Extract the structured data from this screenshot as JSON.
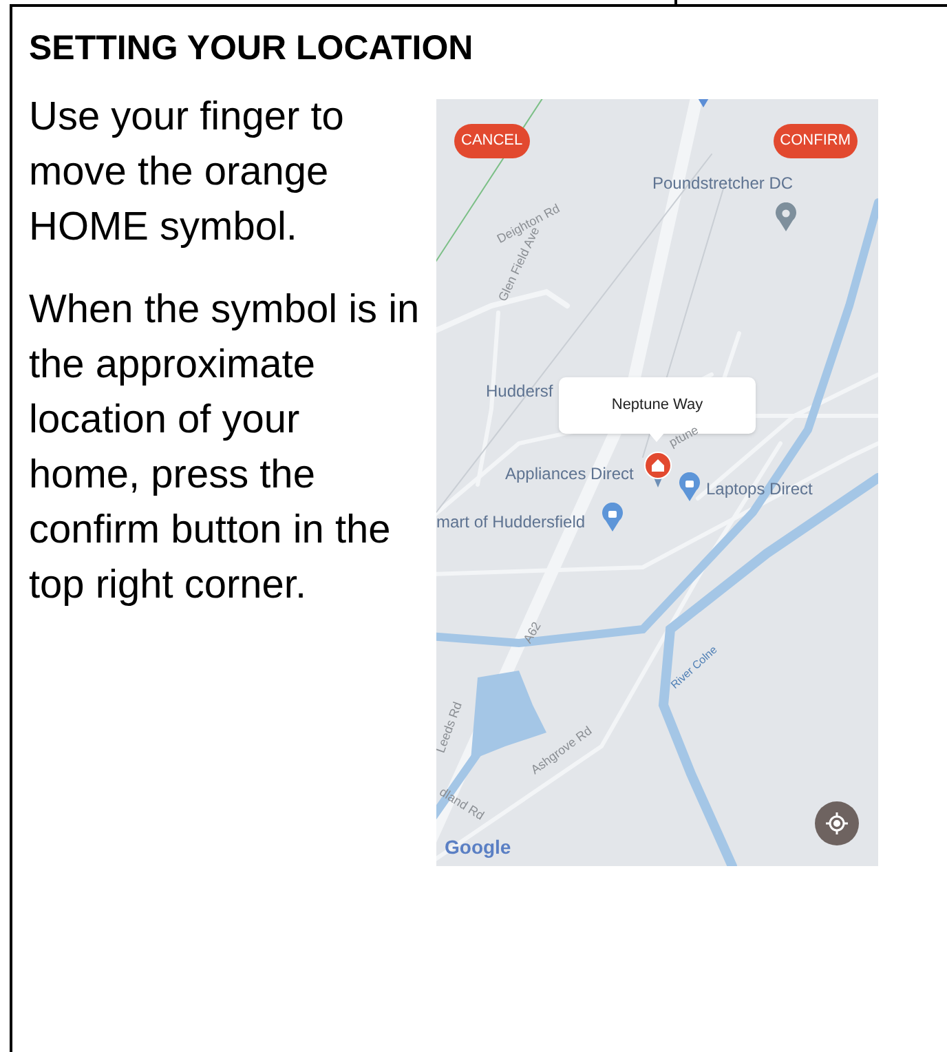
{
  "heading": "SETTING YOUR LOCATION",
  "paragraphs": [
    "Use your finger to move the orange HOME symbol.",
    "When the symbol is in the approximate location of your home, press the confirm button in the top right corner."
  ],
  "phone_screen": {
    "buttons": [
      {
        "label": "CANCEL"
      },
      {
        "label": "CONFIRM"
      }
    ],
    "popup": "Neptune Way",
    "map_labels": [
      {
        "text": "Poundstretcher DC",
        "kind": "place"
      },
      {
        "text": "Deighton Rd",
        "kind": "road"
      },
      {
        "text": "Glen Field Ave",
        "kind": "road"
      },
      {
        "text": "Huddersf",
        "kind": "place"
      },
      {
        "text": "ptune",
        "kind": "road"
      },
      {
        "text": "Appliances Direct",
        "kind": "place"
      },
      {
        "text": "Laptops Direct",
        "kind": "place"
      },
      {
        "text": "mart of Huddersfield",
        "kind": "place"
      },
      {
        "text": "A62",
        "kind": "road"
      },
      {
        "text": "Leeds Rd",
        "kind": "road"
      },
      {
        "text": "River Colne",
        "kind": "water"
      },
      {
        "text": "Ashgrove Rd",
        "kind": "road"
      },
      {
        "text": "dland Rd",
        "kind": "road"
      }
    ],
    "attribution": "Google"
  }
}
